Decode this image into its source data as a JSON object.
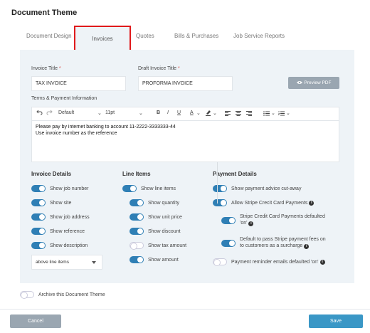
{
  "dialog": {
    "title": "Document Theme"
  },
  "tabs": [
    {
      "label": "Document Design"
    },
    {
      "label": "Invoices"
    },
    {
      "label": "Quotes"
    },
    {
      "label": "Bills & Purchases"
    },
    {
      "label": "Job Service Reports"
    }
  ],
  "active_tab": "Invoices",
  "fields": {
    "invoice_title": {
      "label": "Invoice Title",
      "required_mark": "*",
      "value": "TAX INVOICE"
    },
    "draft_title": {
      "label": "Draft Invoice Title",
      "required_mark": "*",
      "value": "PROFORMA INVOICE"
    },
    "preview_label": "Preview PDF",
    "terms_label": "Terms & Payment Information"
  },
  "editor": {
    "font": "Default",
    "size": "11pt",
    "lines": [
      "Please pay by internet banking to account 11-2222-3333333-44",
      "Use invoice number as the reference"
    ]
  },
  "invoice_details": {
    "title": "Invoice Details",
    "items": [
      {
        "label": "Show job number",
        "on": true
      },
      {
        "label": "Show site",
        "on": true
      },
      {
        "label": "Show job address",
        "on": true
      },
      {
        "label": "Show reference",
        "on": true
      },
      {
        "label": "Show description",
        "on": true
      }
    ],
    "select_value": "above line items"
  },
  "line_items": {
    "title": "Line Items",
    "master": {
      "label": "Show line items",
      "on": true
    },
    "items": [
      {
        "label": "Show quantity",
        "on": true
      },
      {
        "label": "Show unit price",
        "on": true
      },
      {
        "label": "Show discount",
        "on": true
      },
      {
        "label": "Show tax amount",
        "on": false
      },
      {
        "label": "Show amount",
        "on": true
      }
    ]
  },
  "payment_details": {
    "title": "Payment Details",
    "items": [
      {
        "label": "Show payment advice cut-away",
        "on": true
      },
      {
        "label": "Allow Stripe Crecit Card Payments",
        "on": true
      }
    ],
    "sub_items": [
      {
        "line1": "Stripe Credit Card Payments defaulted",
        "line2": "'on'",
        "on": true
      },
      {
        "line1": "Default to pass Stripe payment fees on",
        "line2": "to customers as a surcharge",
        "on": true
      }
    ],
    "reminder": {
      "label": "Payment reminder emails defaulted 'on'",
      "on": false
    }
  },
  "archive": {
    "label": "Archive this Document Theme",
    "on": false
  },
  "footer": {
    "cancel": "Cancel",
    "save": "Save"
  },
  "colors": {
    "accent": "#2f7fb5",
    "highlight": "#e0191b",
    "panel_bg": "#eef3f7",
    "save": "#3a97c6",
    "muted_button": "#9aa6b1"
  }
}
